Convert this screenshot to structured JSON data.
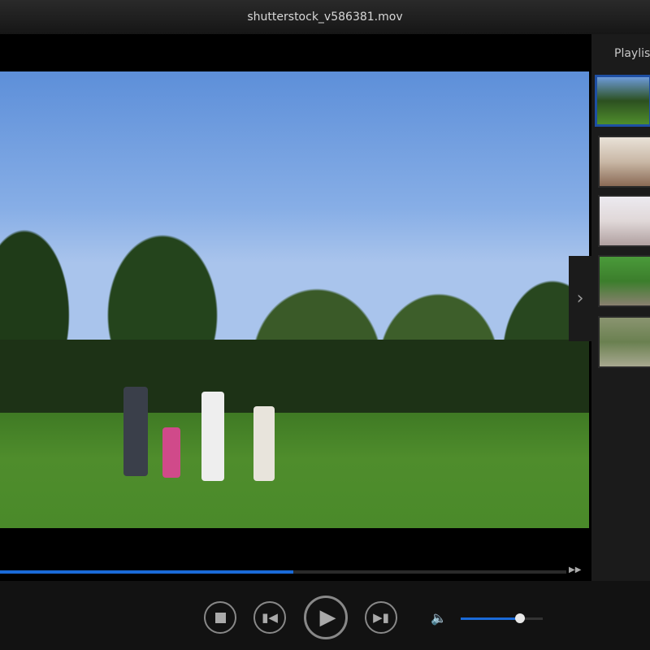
{
  "window": {
    "title": "shutterstock_v586381.mov"
  },
  "sidebar": {
    "title": "Playlist",
    "items": [
      {
        "name": "park-family",
        "selected": true,
        "colors": [
          "#6d9ad8",
          "#2c5020",
          "#4f8d2c"
        ]
      },
      {
        "name": "baby",
        "selected": false,
        "colors": [
          "#e9e2d8",
          "#c9b8a6",
          "#8a6a55"
        ]
      },
      {
        "name": "fitness-woman",
        "selected": false,
        "colors": [
          "#eceaf0",
          "#e0d8d8",
          "#b0a0a0"
        ]
      },
      {
        "name": "grass-lying",
        "selected": false,
        "colors": [
          "#4a9a3a",
          "#3c7e2c",
          "#8a8070"
        ]
      },
      {
        "name": "rocks-grass",
        "selected": false,
        "colors": [
          "#8a9470",
          "#6a8050",
          "#a8a890"
        ]
      }
    ]
  },
  "player": {
    "progress_percent": 51.8,
    "volume_percent": 72
  },
  "icons": {
    "stop": "stop-icon",
    "prev": "previous-icon",
    "play": "play-icon",
    "next": "next-icon",
    "volume": "speaker-icon",
    "expand": "chevron-right-icon",
    "ff": "fast-forward-icon"
  },
  "colors": {
    "accent": "#1a6ad8",
    "selected_border": "#1e4fa3"
  }
}
